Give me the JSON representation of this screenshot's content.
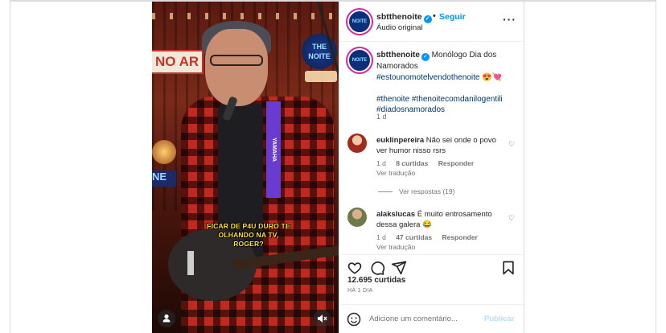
{
  "video": {
    "set_sign": "NO AR",
    "show_logo": "THE NOITE",
    "shelf_sign": "NE",
    "strap_text": "YAMAHA",
    "caption_line": "FICAR DE P4U DURO TE OLHANDO NA TV, ROGER?"
  },
  "post": {
    "username": "sbtthenoite",
    "dot": "•",
    "follow": "Seguir",
    "audio": "Áudio original",
    "caption_text": "Monólogo Dia dos Namorados",
    "hashtags1": "#estounomotelvendothenoite",
    "emoji1": "😍💘",
    "hashtags2": "#thenoite #thenoitecomdanilogentili #diadosnamorados",
    "caption_time": "1 d"
  },
  "comments": [
    {
      "username": "euklinpereira",
      "text": "Não sei onde o povo ver humor nisso rsrs",
      "time": "1 d",
      "likes": "8 curtidas",
      "reply": "Responder",
      "translate": "Ver tradução",
      "view_replies": "Ver respostas (19)"
    },
    {
      "username": "alakslucas",
      "text": "É muito entrosamento dessa galera 😂",
      "time": "1 d",
      "likes": "47 curtidas",
      "reply": "Responder",
      "translate": "Ver tradução"
    }
  ],
  "actions": {
    "likes_count": "12.695 curtidas",
    "posted_ago": "HÁ 1 DIA",
    "comment_placeholder": "Adicione um comentário...",
    "publish": "Publicar"
  },
  "icons": {
    "verified": "verified-badge-icon",
    "more": "more-options-icon",
    "heart": "heart-icon",
    "comment": "comment-icon",
    "share": "share-icon",
    "save": "bookmark-icon",
    "emoji": "emoji-icon",
    "tag": "user-tag-icon",
    "mute": "mute-icon"
  },
  "colors": {
    "link_blue": "#0095f6",
    "hashtag": "#00376b",
    "muted": "#737373",
    "publish_disabled": "#b2dffc"
  }
}
